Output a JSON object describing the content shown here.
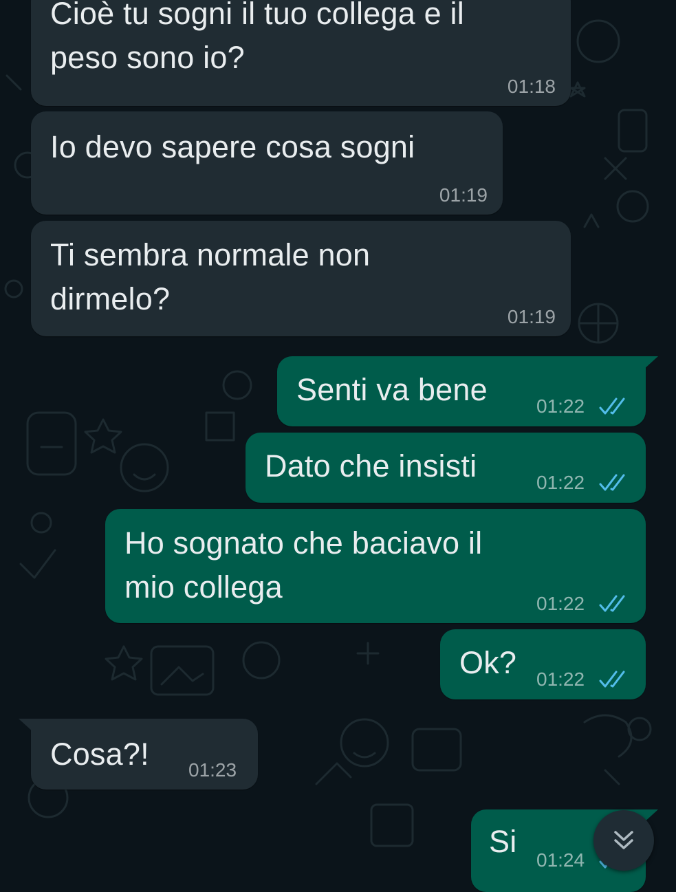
{
  "theme": {
    "background": "#0b141a",
    "incoming_bubble": "#202c33",
    "outgoing_bubble": "#005c4b",
    "text_color": "#e9edef",
    "read_tick_color": "#53bdeb"
  },
  "messages": [
    {
      "direction": "incoming",
      "lines": [
        "Cioè tu sogni il tuo collega e il",
        "peso sono io?"
      ],
      "time": "01:18"
    },
    {
      "direction": "incoming",
      "lines": [
        "Io devo sapere cosa sogni"
      ],
      "time": "01:19"
    },
    {
      "direction": "incoming",
      "lines": [
        "Ti sembra normale non",
        "dirmelo?"
      ],
      "time": "01:19"
    },
    {
      "direction": "outgoing",
      "lines": [
        "Senti va bene"
      ],
      "time": "01:22",
      "status": "read"
    },
    {
      "direction": "outgoing",
      "lines": [
        "Dato che insisti"
      ],
      "time": "01:22",
      "status": "read"
    },
    {
      "direction": "outgoing",
      "lines": [
        "Ho sognato che baciavo il",
        "mio collega"
      ],
      "time": "01:22",
      "status": "read"
    },
    {
      "direction": "outgoing",
      "lines": [
        "Ok?"
      ],
      "time": "01:22",
      "status": "read"
    },
    {
      "direction": "incoming",
      "lines": [
        "Cosa?!"
      ],
      "time": "01:23"
    },
    {
      "direction": "outgoing",
      "lines": [
        "Si"
      ],
      "time": "01:24",
      "status": "read"
    }
  ],
  "scroll_button": {
    "icon": "double-chevron-down-icon"
  }
}
